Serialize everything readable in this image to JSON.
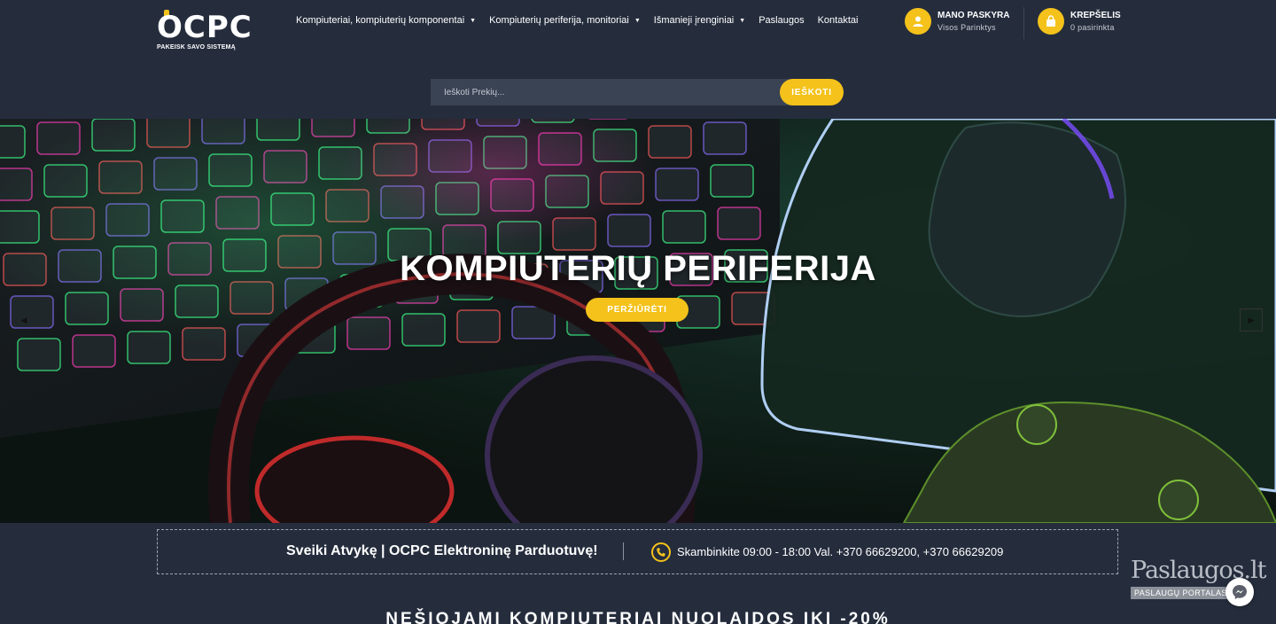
{
  "brand": {
    "logo_text": "OCPC",
    "tagline": "PAKEISK SAVO SISTEMĄ",
    "accent_color": "#f4c21a",
    "background_color": "#252d3d"
  },
  "nav": {
    "items": [
      {
        "label": "Kompiuteriai, kompiuterių komponentai",
        "has_dropdown": true
      },
      {
        "label": "Kompiuterių periferija, monitoriai",
        "has_dropdown": true
      },
      {
        "label": "Išmanieji įrenginiai",
        "has_dropdown": true
      },
      {
        "label": "Paslaugos",
        "has_dropdown": false
      },
      {
        "label": "Kontaktai",
        "has_dropdown": false
      }
    ],
    "caret": "▼"
  },
  "account": {
    "title": "MANO PASKYRA",
    "subtitle": "Visos Parinktys",
    "icon": "user-icon"
  },
  "cart": {
    "title": "KREPŠELIS",
    "subtitle": "0 pasirinkta",
    "icon": "shopping-bag-icon"
  },
  "search": {
    "placeholder": "Ieškoti Prekių...",
    "button_label": "IEŠKOTI"
  },
  "hero": {
    "title": "KOMPIUTERIŲ PERIFERIJA",
    "button_label": "PERŽIŪRĖTI",
    "prev_icon": "chevron-left-icon",
    "next_icon": "chevron-right-icon"
  },
  "welcome": {
    "title": "Sveiki Atvykę | OCPC Elektroninę Parduotuvę!",
    "phone_text": "Skambinkite 09:00 - 18:00 Val. +370 66629200, +370 66629209",
    "icon": "phone-icon"
  },
  "section": {
    "title": "NEŠIOJAMI KOMPIUTERIAI NUOLAIDOS IKI -20%"
  },
  "watermark": {
    "title": "Paslaugos.lt",
    "subtitle": "PASLAUGŲ PORTALAS"
  },
  "chat": {
    "icon": "messenger-icon"
  }
}
